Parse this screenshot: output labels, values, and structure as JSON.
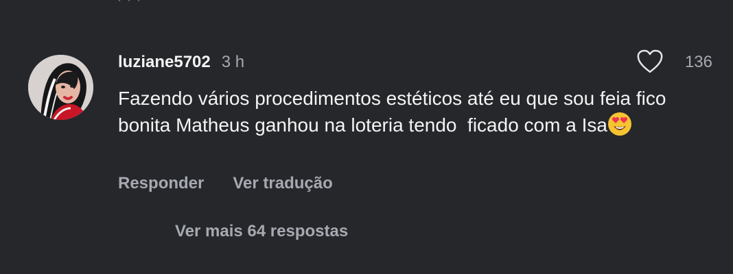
{
  "comment": {
    "username": "luziane5702",
    "time": "3 h",
    "like_count": "136",
    "text": "Fazendo vários procedimentos estéticos até eu que sou feia fico bonita Matheus ganhou na loteria tendo  ficado com a Isa",
    "emoji": "heart-eyes-emoji"
  },
  "actions": {
    "reply": "Responder",
    "translate": "Ver tradução"
  },
  "replies": {
    "label": "Ver mais 64 respostas"
  },
  "icons": {
    "like": "heart-outline-icon"
  },
  "colors": {
    "background": "#25272b",
    "primary_text": "#f4f4f4",
    "secondary_text": "#a6aab0"
  }
}
